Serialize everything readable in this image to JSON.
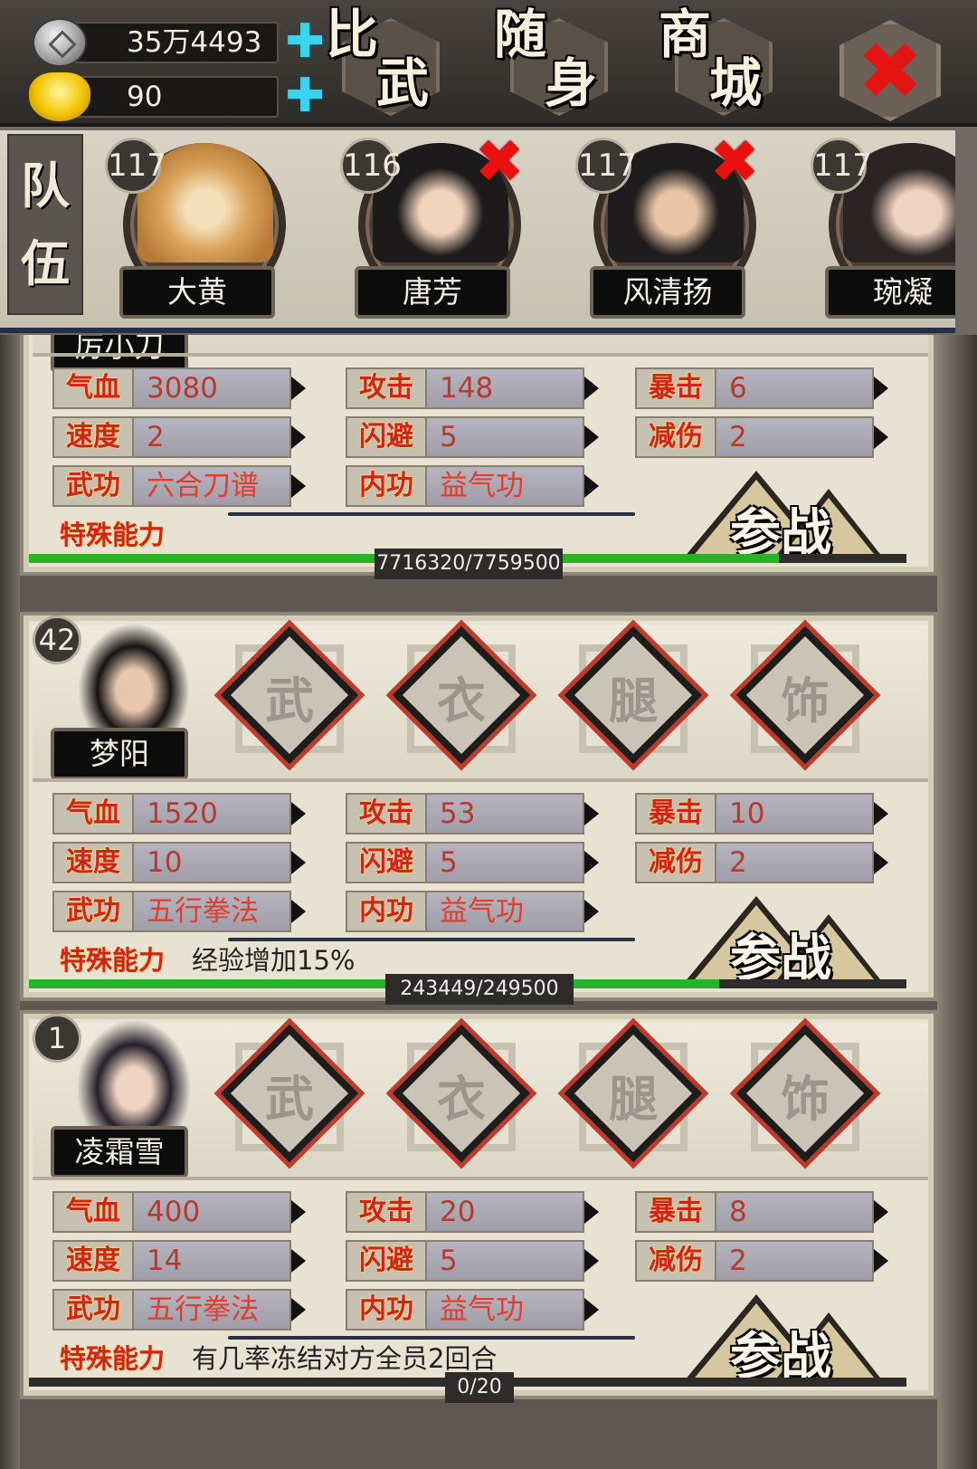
{
  "currency": {
    "silver": "35万4493",
    "gold": "90",
    "plus_glyph": "✚"
  },
  "nav": {
    "pvp": [
      "比",
      "武"
    ],
    "carry": [
      "随",
      "身"
    ],
    "shop": [
      "商",
      "城"
    ],
    "close_glyph": "✖"
  },
  "team": {
    "tab_label": [
      "队",
      "伍"
    ],
    "remove_glyph": "✖",
    "members": [
      {
        "level": "117",
        "name": "大黄"
      },
      {
        "level": "116",
        "name": "唐芳"
      },
      {
        "level": "117",
        "name": "风清扬"
      },
      {
        "level": "117",
        "name": "琬凝"
      }
    ]
  },
  "slot_glyphs": [
    "武",
    "衣",
    "腿",
    "饰"
  ],
  "stat_labels": {
    "hp": "气血",
    "atk": "攻击",
    "crit": "暴击",
    "spd": "速度",
    "dodge": "闪避",
    "dmgred": "减伤",
    "martial": "武功",
    "inner": "内功",
    "special": "特殊能力"
  },
  "join_label": "参战",
  "cards": [
    {
      "name": "厉小刀",
      "stats": {
        "hp": "3080",
        "atk": "148",
        "crit": "6",
        "spd": "2",
        "dodge": "5",
        "dmgred": "2"
      },
      "martial": "六合刀谱",
      "inner": "益气功",
      "special": "",
      "exp": "7716320/7759500",
      "exp_ratio": 0.8544
    },
    {
      "level": "42",
      "name": "梦阳",
      "stats": {
        "hp": "1520",
        "atk": "53",
        "crit": "10",
        "spd": "10",
        "dodge": "5",
        "dmgred": "2"
      },
      "martial": "五行拳法",
      "inner": "益气功",
      "special": "经验增加15%",
      "exp": "243449/249500",
      "exp_ratio": 0.7861
    },
    {
      "level": "1",
      "name": "凌霜雪",
      "stats": {
        "hp": "400",
        "atk": "20",
        "crit": "8",
        "spd": "14",
        "dodge": "5",
        "dmgred": "2"
      },
      "martial": "五行拳法",
      "inner": "益气功",
      "special": "有几率冻结对方全员2回合",
      "exp": "0/20",
      "exp_ratio": 0.0
    }
  ]
}
